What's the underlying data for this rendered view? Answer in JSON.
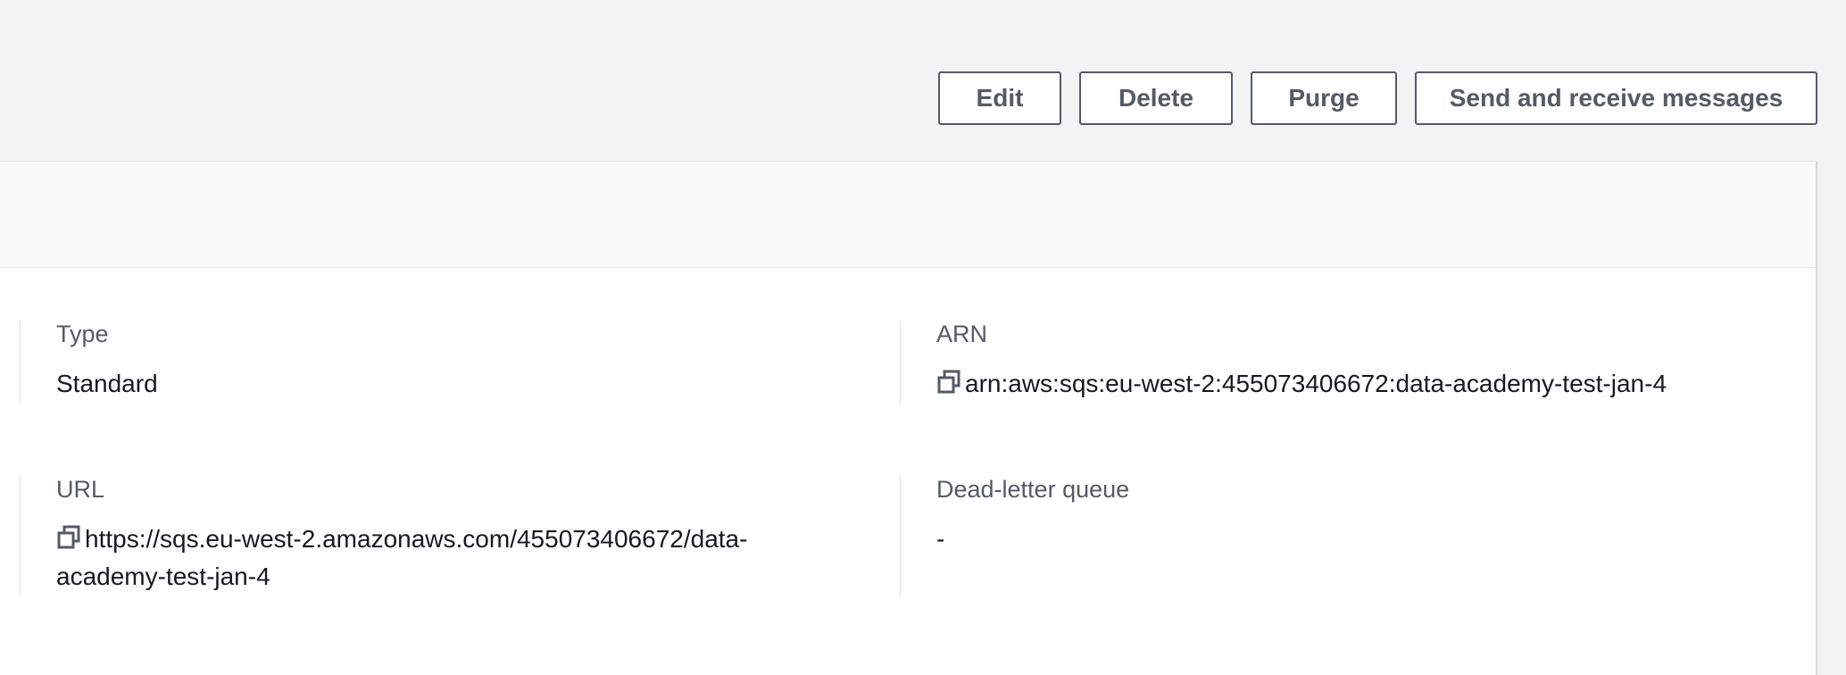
{
  "actions": {
    "edit": "Edit",
    "delete": "Delete",
    "purge": "Purge",
    "send_receive": "Send and receive messages"
  },
  "details": {
    "type": {
      "label": "Type",
      "value": "Standard"
    },
    "arn": {
      "label": "ARN",
      "value": "arn:aws:sqs:eu-west-2:455073406672:data-academy-test-jan-4",
      "icon": "copy-icon"
    },
    "url": {
      "label": "URL",
      "value": "https://sqs.eu-west-2.amazonaws.com/455073406672/data-academy-test-jan-4",
      "icon": "copy-icon"
    },
    "dead_letter_queue": {
      "label": "Dead-letter queue",
      "value": "-"
    }
  },
  "colors": {
    "page_background": "#f2f3f3",
    "button_border": "#545b64",
    "label_text": "#545b64",
    "value_text": "#16191f"
  }
}
